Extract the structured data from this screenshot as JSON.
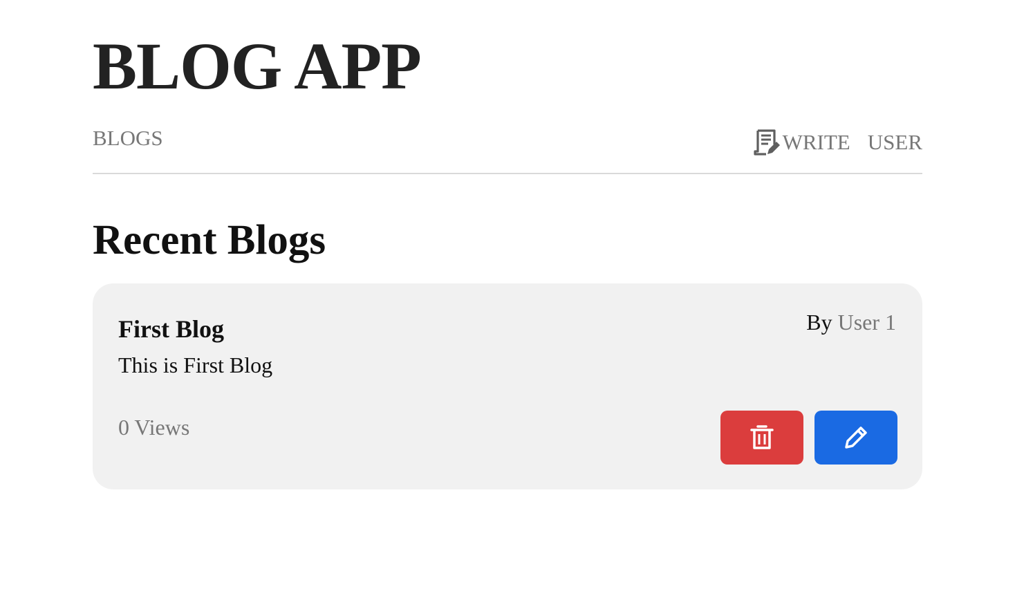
{
  "header": {
    "title": "BLOG APP"
  },
  "nav": {
    "blogs_label": "BLOGS",
    "write_label": "WRITE",
    "user_label": "USER",
    "write_icon": "write-document-icon"
  },
  "main": {
    "section_title": "Recent Blogs",
    "blogs": [
      {
        "title": "First Blog",
        "author_prefix": "By",
        "author": "User 1",
        "body": "This is First Blog",
        "views": "0 Views",
        "delete_icon": "trash-icon",
        "edit_icon": "pencil-icon"
      }
    ]
  },
  "colors": {
    "delete_button": "#db3d3d",
    "edit_button": "#1a6ae3",
    "card_background": "#f1f1f1",
    "muted_text": "#777777"
  }
}
